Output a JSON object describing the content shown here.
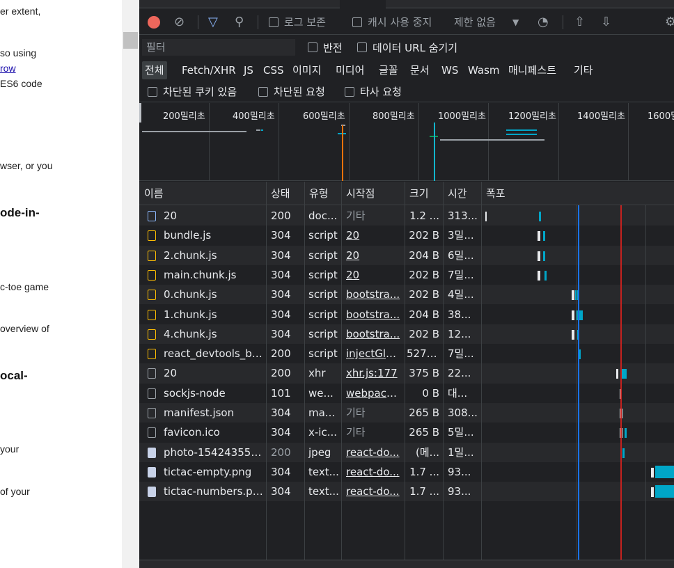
{
  "page": {
    "lines": [
      {
        "text": "er extent,",
        "style": "normal"
      },
      {
        "text": "so using",
        "style": "normal"
      },
      {
        "text": "row",
        "style": "link"
      },
      {
        "text": "ES6 code",
        "style": "normal"
      },
      {
        "text": "wser, or you",
        "style": "normal"
      },
      {
        "text": "ode-in-",
        "style": "bold"
      },
      {
        "text": "c-toe game",
        "style": "normal"
      },
      {
        "text": "overview of",
        "style": "normal"
      },
      {
        "text": "ocal-",
        "style": "bold"
      },
      {
        "text": "your",
        "style": "normal"
      },
      {
        "text": "of your",
        "style": "normal"
      }
    ]
  },
  "toolbar": {
    "preserve_log": "로그 보존",
    "disable_cache": "캐시 사용 중지",
    "throttle": "제한 없음",
    "filter_placeholder": "필터",
    "invert": "반전",
    "hide_data_urls": "데이터 URL 숨기기",
    "blocked_cookies": "차단된 쿠키 있음",
    "blocked_requests": "차단된 요청",
    "third_party": "타사 요청"
  },
  "filter_types": [
    "전체",
    "Fetch/XHR",
    "JS",
    "CSS",
    "이미지",
    "미디어",
    "글꼴",
    "문서",
    "WS",
    "Wasm",
    "매니페스트",
    "기타"
  ],
  "overview_labels": [
    "200밀리초",
    "400밀리초",
    "600밀리초",
    "800밀리초",
    "1000밀리초",
    "1200밀리초",
    "1400밀리초",
    "1600밀리초"
  ],
  "columns": {
    "name": "이름",
    "status": "상태",
    "type": "유형",
    "initiator": "시작점",
    "size": "크기",
    "time": "시간",
    "waterfall": "폭포"
  },
  "requests": [
    {
      "name": "20",
      "status": "200",
      "type": "doc...",
      "initiator": "기타",
      "init_link": false,
      "size": "1.2 ...",
      "time": "313...",
      "icon": "doc"
    },
    {
      "name": "bundle.js",
      "status": "304",
      "type": "script",
      "initiator": "20",
      "init_link": true,
      "size": "202 B",
      "time": "3밀...",
      "icon": "script"
    },
    {
      "name": "2.chunk.js",
      "status": "304",
      "type": "script",
      "initiator": "20",
      "init_link": true,
      "size": "204 B",
      "time": "6밀...",
      "icon": "script"
    },
    {
      "name": "main.chunk.js",
      "status": "304",
      "type": "script",
      "initiator": "20",
      "init_link": true,
      "size": "202 B",
      "time": "7밀...",
      "icon": "script"
    },
    {
      "name": "0.chunk.js",
      "status": "304",
      "type": "script",
      "initiator": "bootstra...",
      "init_link": true,
      "size": "202 B",
      "time": "4밀...",
      "icon": "script"
    },
    {
      "name": "1.chunk.js",
      "status": "304",
      "type": "script",
      "initiator": "bootstra...",
      "init_link": true,
      "size": "204 B",
      "time": "38...",
      "icon": "script"
    },
    {
      "name": "4.chunk.js",
      "status": "304",
      "type": "script",
      "initiator": "bootstra...",
      "init_link": true,
      "size": "202 B",
      "time": "12...",
      "icon": "script"
    },
    {
      "name": "react_devtools_ba...",
      "status": "200",
      "type": "script",
      "initiator": "injectGlo...",
      "init_link": true,
      "size": "527 ...",
      "time": "7밀...",
      "icon": "script"
    },
    {
      "name": "20",
      "status": "200",
      "type": "xhr",
      "initiator": "xhr.js:177",
      "init_link": true,
      "size": "375 B",
      "time": "22...",
      "icon": "other"
    },
    {
      "name": "sockjs-node",
      "status": "101",
      "type": "we...",
      "initiator": "webpack...",
      "init_link": true,
      "size": "0 B",
      "time": "대...",
      "icon": "other"
    },
    {
      "name": "manifest.json",
      "status": "304",
      "type": "ma...",
      "initiator": "기타",
      "init_link": false,
      "size": "265 B",
      "time": "308...",
      "icon": "other"
    },
    {
      "name": "favicon.ico",
      "status": "304",
      "type": "x-ic...",
      "initiator": "기타",
      "init_link": false,
      "size": "265 B",
      "time": "5밀...",
      "icon": "other"
    },
    {
      "name": "photo-154243550...",
      "status": "200",
      "type": "jpeg",
      "initiator": "react-do...",
      "init_link": true,
      "size": "(메...",
      "time": "1밀...",
      "icon": "img",
      "dim_status": true
    },
    {
      "name": "tictac-empty.png",
      "status": "304",
      "type": "text...",
      "initiator": "react-do...",
      "init_link": true,
      "size": "1.7 ...",
      "time": "93...",
      "icon": "img"
    },
    {
      "name": "tictac-numbers.png",
      "status": "304",
      "type": "text...",
      "initiator": "react-do...",
      "init_link": true,
      "size": "1.7 ...",
      "time": "93...",
      "icon": "img"
    }
  ],
  "colors": {
    "record": "#ee675c",
    "dom_content_loaded": "#1a73e8",
    "load": "#c5221f",
    "waterfall_bar": "#00a6c8",
    "waiting": "#e8eaed"
  }
}
